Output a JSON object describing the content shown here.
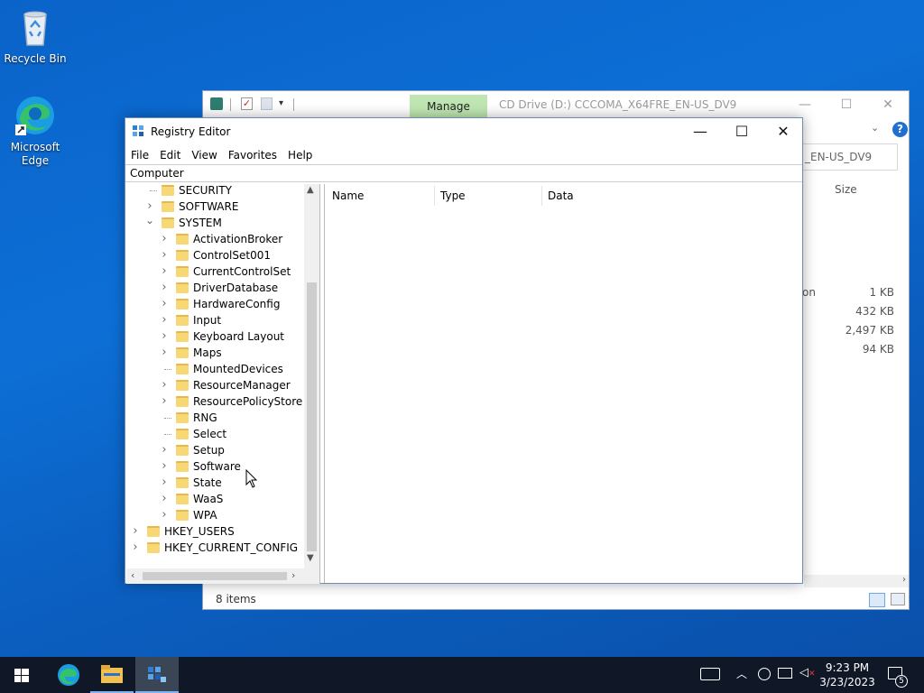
{
  "desktop": {
    "icons": [
      {
        "label": "Recycle Bin"
      },
      {
        "label": "Microsoft Edge"
      }
    ]
  },
  "explorer": {
    "manage_tab": "Manage",
    "title": "CD Drive (D:) CCCOMA_X64FRE_EN-US_DV9",
    "address_partial": "_EN-US_DV9",
    "size_header": "Size",
    "type_partial": "on",
    "sizes": [
      "1 KB",
      "432 KB",
      "2,497 KB",
      "94 KB"
    ],
    "status": "8 items"
  },
  "regedit": {
    "title": "Registry Editor",
    "menu": [
      "File",
      "Edit",
      "View",
      "Favorites",
      "Help"
    ],
    "address": "Computer",
    "tree": [
      {
        "label": "SECURITY",
        "level": 1,
        "expander": "none"
      },
      {
        "label": "SOFTWARE",
        "level": 1,
        "expander": "collapsed"
      },
      {
        "label": "SYSTEM",
        "level": 1,
        "expander": "expanded"
      },
      {
        "label": "ActivationBroker",
        "level": 2,
        "expander": "collapsed"
      },
      {
        "label": "ControlSet001",
        "level": 2,
        "expander": "collapsed"
      },
      {
        "label": "CurrentControlSet",
        "level": 2,
        "expander": "collapsed"
      },
      {
        "label": "DriverDatabase",
        "level": 2,
        "expander": "collapsed"
      },
      {
        "label": "HardwareConfig",
        "level": 2,
        "expander": "collapsed"
      },
      {
        "label": "Input",
        "level": 2,
        "expander": "collapsed"
      },
      {
        "label": "Keyboard Layout",
        "level": 2,
        "expander": "collapsed"
      },
      {
        "label": "Maps",
        "level": 2,
        "expander": "collapsed"
      },
      {
        "label": "MountedDevices",
        "level": 2,
        "expander": "none"
      },
      {
        "label": "ResourceManager",
        "level": 2,
        "expander": "collapsed"
      },
      {
        "label": "ResourcePolicyStore",
        "level": 2,
        "expander": "collapsed"
      },
      {
        "label": "RNG",
        "level": 2,
        "expander": "none"
      },
      {
        "label": "Select",
        "level": 2,
        "expander": "none"
      },
      {
        "label": "Setup",
        "level": 2,
        "expander": "collapsed"
      },
      {
        "label": "Software",
        "level": 2,
        "expander": "collapsed"
      },
      {
        "label": "State",
        "level": 2,
        "expander": "collapsed"
      },
      {
        "label": "WaaS",
        "level": 2,
        "expander": "collapsed"
      },
      {
        "label": "WPA",
        "level": 2,
        "expander": "collapsed"
      },
      {
        "label": "HKEY_USERS",
        "level": 0,
        "expander": "collapsed"
      },
      {
        "label": "HKEY_CURRENT_CONFIG",
        "level": 0,
        "expander": "collapsed"
      }
    ],
    "columns": [
      "Name",
      "Type",
      "Data"
    ]
  },
  "taskbar": {
    "time": "9:23 PM",
    "date": "3/23/2023",
    "notification_count": "5",
    "icons": [
      "start-icon",
      "edge-icon",
      "file-explorer-icon",
      "registry-editor-icon"
    ]
  },
  "colors": {
    "desktop": "#0b62c6",
    "taskbar": "#101828",
    "manage_tab": "#bfe6b2",
    "folder": "#f8d775"
  }
}
